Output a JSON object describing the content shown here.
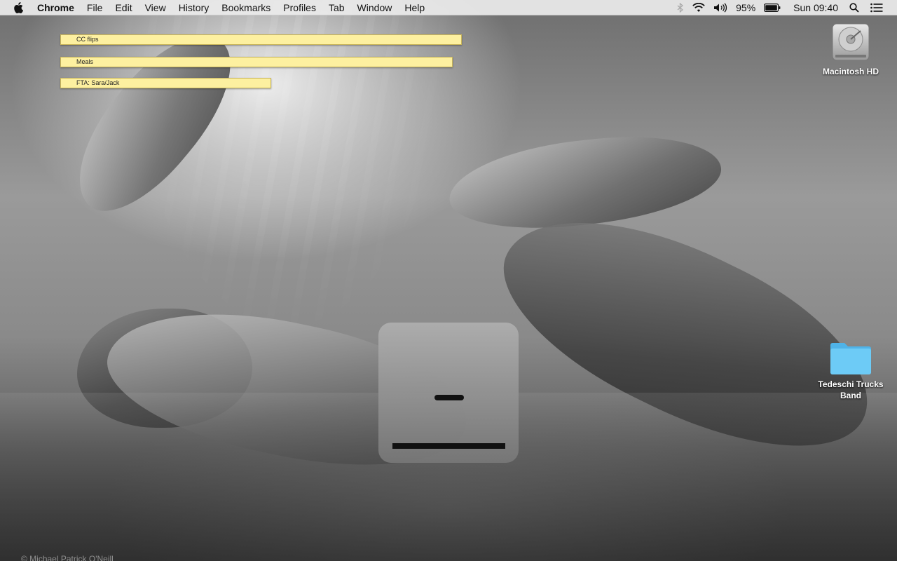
{
  "menubar": {
    "app_name": "Chrome",
    "menus": [
      "File",
      "Edit",
      "View",
      "History",
      "Bookmarks",
      "Profiles",
      "Tab",
      "Window",
      "Help"
    ],
    "battery_percent": "95%",
    "clock": "Sun 09:40"
  },
  "stickies": [
    {
      "title": "CC flips"
    },
    {
      "title": "Meals"
    },
    {
      "title": "FTA: Sara/Jack"
    }
  ],
  "desktop": {
    "icons": [
      {
        "label": "Macintosh HD"
      },
      {
        "label": "Tedeschi Trucks Band"
      }
    ]
  },
  "hud": {
    "kind": "volume-muted",
    "level": 0
  },
  "wallpaper": {
    "credit": "© Michael Patrick O'Neill"
  },
  "colors": {
    "sticky_yellow": "#fdf0a0",
    "folder_blue": "#5fc4f4"
  }
}
